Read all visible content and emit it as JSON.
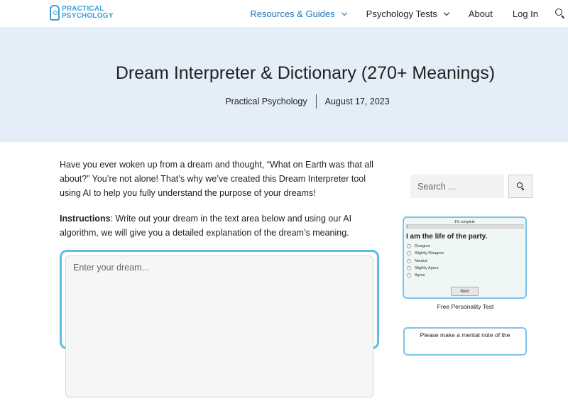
{
  "header": {
    "logo_line1": "PRACTICAL",
    "logo_line2": "PSYCHOLOGY",
    "nav": [
      {
        "label": "Resources & Guides"
      },
      {
        "label": "Psychology Tests"
      },
      {
        "label": "About"
      },
      {
        "label": "Log In"
      }
    ]
  },
  "hero": {
    "title": "Dream Interpreter & Dictionary (270+ Meanings)",
    "author": "Practical Psychology",
    "date": "August 17, 2023"
  },
  "content": {
    "intro": "Have you ever woken up from a dream and thought, “What on Earth was that all about?” You’re not alone! That’s why we’ve created this Dream Interpreter tool using AI to help you fully understand the purpose of your dreams!",
    "instructions_label": "Instructions",
    "instructions_text": ": Write out your dream in the text area below and using our AI algorithm, we will give you a detailed explanation of the dream’s meaning.",
    "dream_placeholder": "Enter your dream..."
  },
  "sidebar": {
    "search_placeholder": "Search ...",
    "quiz": {
      "progress_label": "1% complete",
      "progress": 0.01,
      "question": "I am the life of the party.",
      "options": [
        "Disagree",
        "Slightly Disagree",
        "Neutral",
        "Slightly Agree",
        "Agree"
      ],
      "next_label": "Next"
    },
    "quiz_caption": "Free Personality Test",
    "note_text": "Please make a mental note of the"
  },
  "colors": {
    "accent": "#1e73be",
    "hero_bg": "#e4eef8",
    "box_border": "#5dbde6"
  }
}
